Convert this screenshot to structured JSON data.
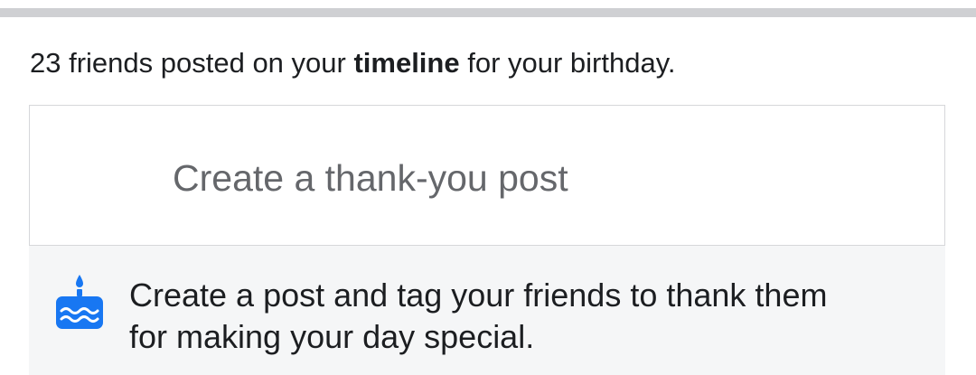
{
  "summary": {
    "prefix": "23 friends posted on your ",
    "highlight": "timeline",
    "suffix": " for your birthday."
  },
  "thank_you_box": {
    "placeholder": "Create a thank-you post"
  },
  "tip": {
    "icon": "birthday-cake-icon",
    "text_line1": "Create a post and tag your friends to thank them",
    "text_line2": "for making your day special."
  },
  "colors": {
    "accent": "#1877f2",
    "divider": "#cfd0d3",
    "tip_background": "#f5f6f7",
    "placeholder": "#65676b"
  }
}
